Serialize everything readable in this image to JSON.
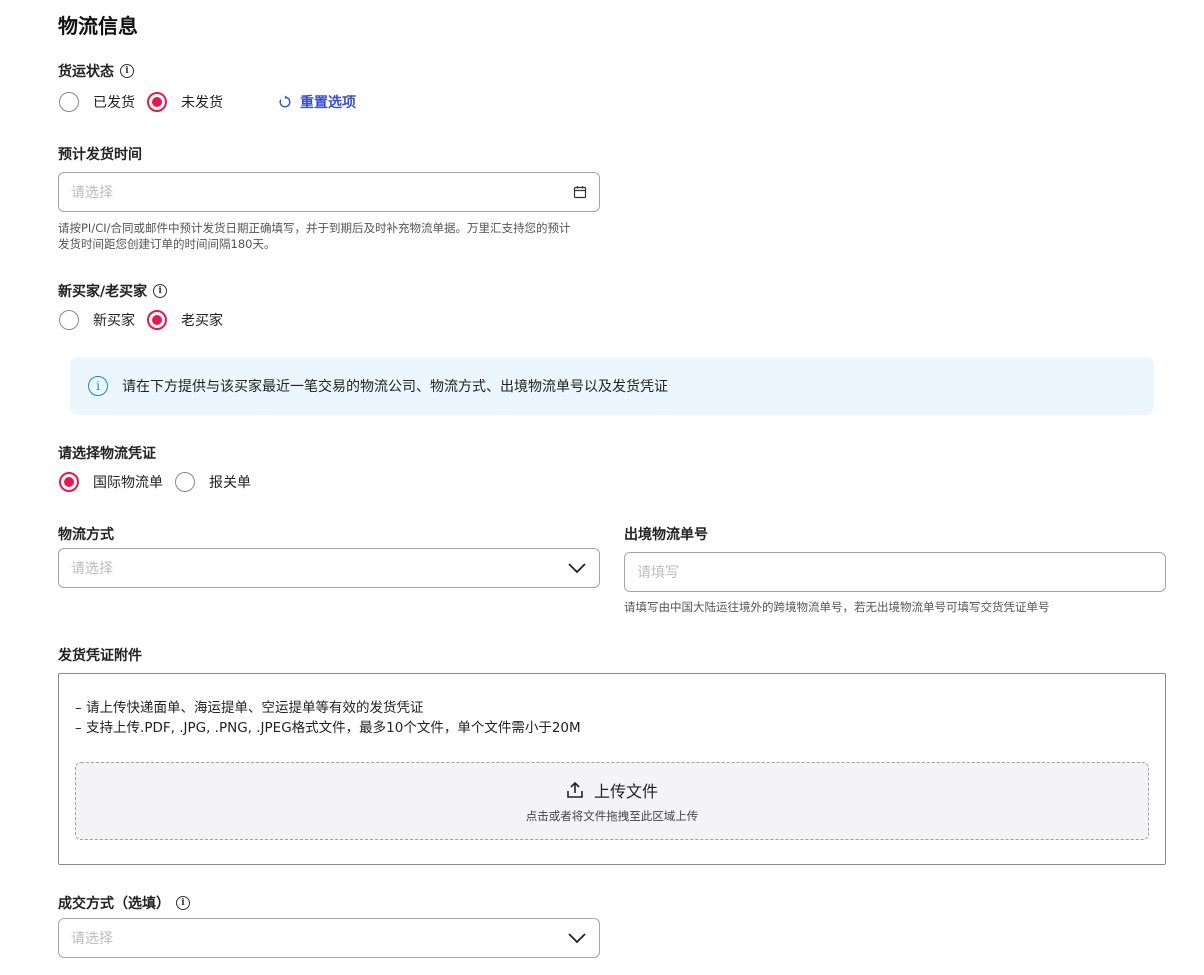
{
  "title": "物流信息",
  "shipping_status": {
    "label": "货运状态",
    "options": [
      "已发货",
      "未发货"
    ],
    "selected_index": 1,
    "reset_label": "重置选项"
  },
  "expected_ship_time": {
    "label": "预计发货时间",
    "placeholder": "请选择",
    "hint_line1": "请按PI/CI/合同或邮件中预计发货日期正确填写，并于到期后及时补充物流单据。万里汇支持您的预计",
    "hint_line2": "发货时间距您创建订单的时间间隔180天。"
  },
  "buyer_type": {
    "label": "新买家/老买家",
    "options": [
      "新买家",
      "老买家"
    ],
    "selected_index": 1
  },
  "notice": "请在下方提供与该买家最近一笔交易的物流公司、物流方式、出境物流单号以及发货凭证",
  "logistics_proof": {
    "label": "请选择物流凭证",
    "options": [
      "国际物流单",
      "报关单"
    ],
    "selected_index": 0
  },
  "logistics_method": {
    "label": "物流方式",
    "placeholder": "请选择"
  },
  "outbound_number": {
    "label": "出境物流单号",
    "placeholder": "请填写",
    "hint": "请填写由中国大陆运往境外的跨境物流单号，若无出境物流单号可填写交货凭证单号"
  },
  "attachment": {
    "label": "发货凭证附件",
    "rule1": "– 请上传快递面单、海运提单、空运提单等有效的发货凭证",
    "rule2": "– 支持上传.PDF, .JPG, .PNG, .JPEG格式文件，最多10个文件，单个文件需小于20M",
    "upload_title": "上传文件",
    "upload_sub": "点击或者将文件拖拽至此区域上传"
  },
  "deal_method": {
    "label": "成交方式（选填）",
    "placeholder": "请选择"
  },
  "colors": {
    "accent": "#e8184f",
    "link": "#3a50c8",
    "notice_bg": "#ecf6fd",
    "info_blue": "#1784d8"
  },
  "icons": [
    "info-icon",
    "reset-icon",
    "calendar-icon",
    "chevron-down-icon",
    "upload-icon"
  ]
}
